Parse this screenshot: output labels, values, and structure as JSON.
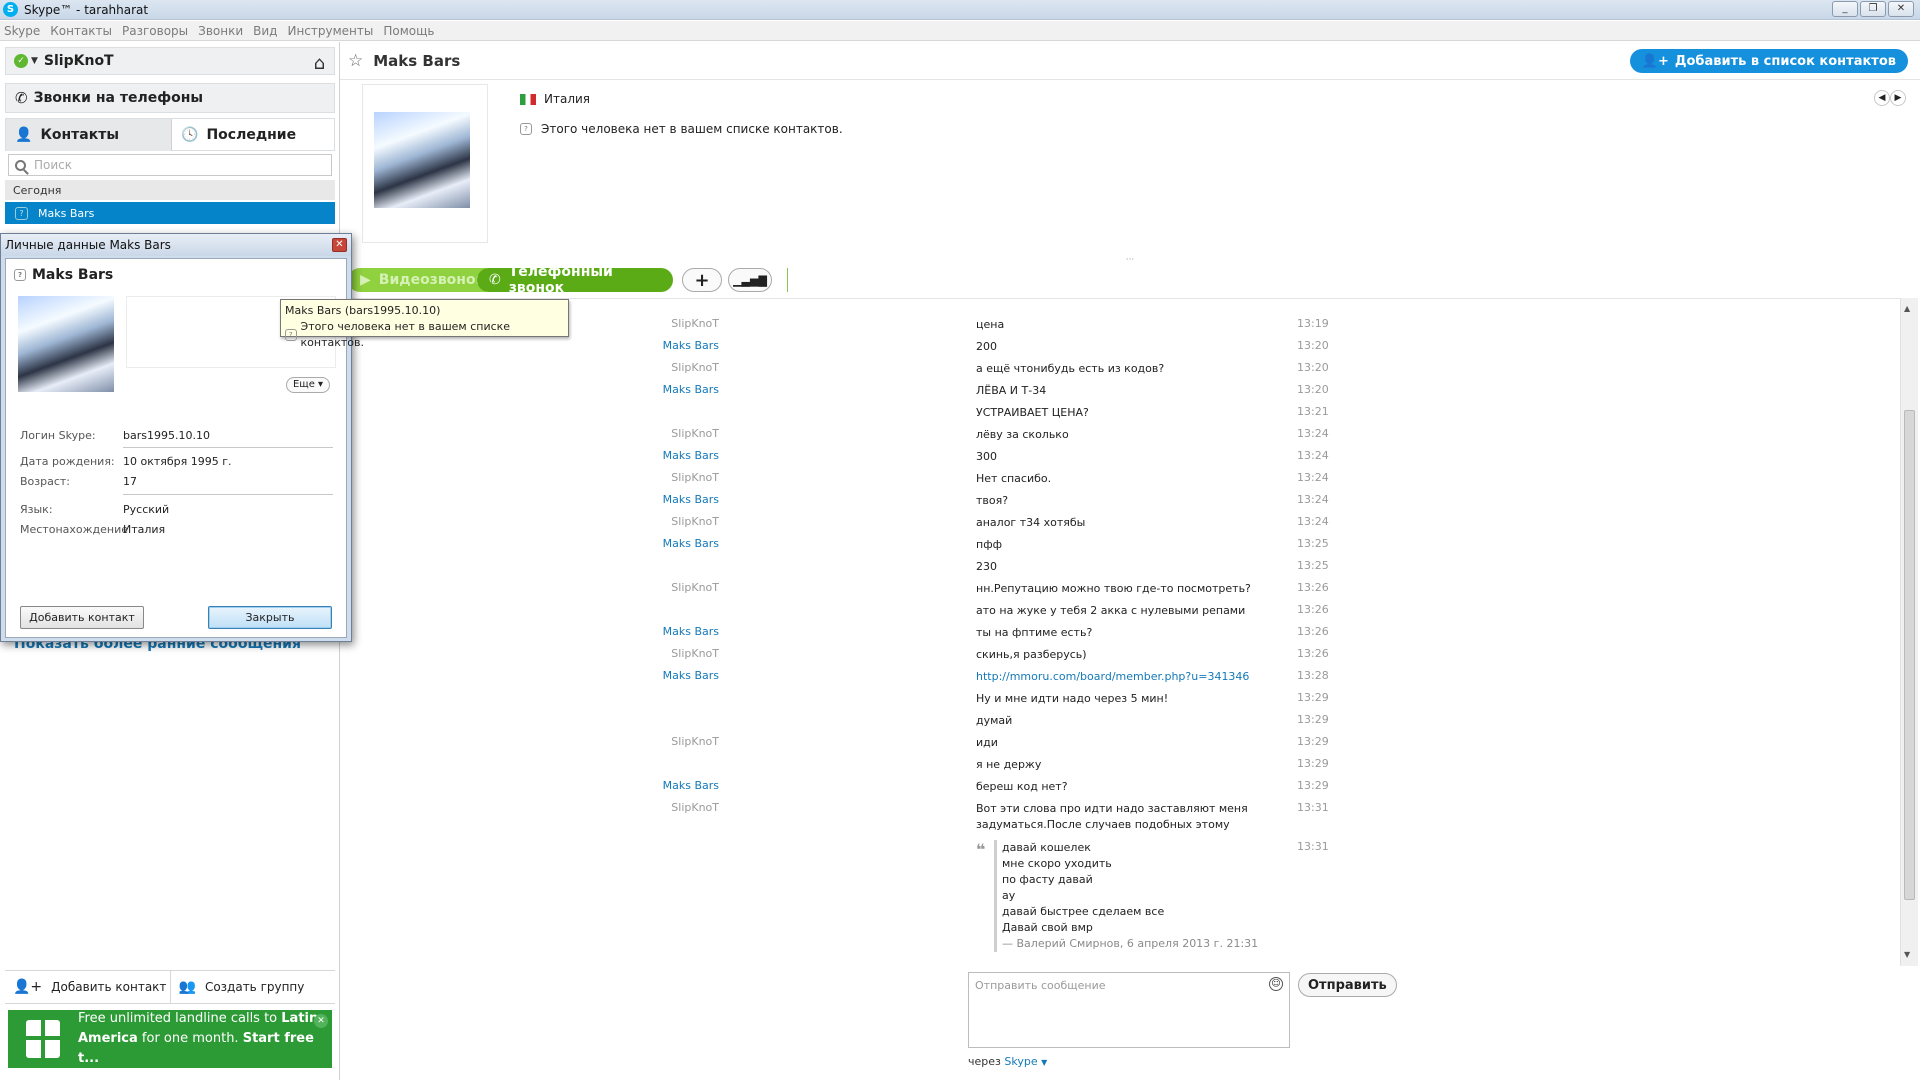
{
  "window": {
    "title": "Skype™ - tarahharat",
    "logo": "skype-logo",
    "controls": [
      "_",
      "❐",
      "✕"
    ]
  },
  "menu": [
    "Skype",
    "Контакты",
    "Разговоры",
    "Звонки",
    "Вид",
    "Инструменты",
    "Помощь"
  ],
  "sidebar": {
    "account_name": "SlipKnoT",
    "phone_calls": "Звонки на телефоны",
    "tabs": {
      "contacts": "Контакты",
      "recent": "Последние"
    },
    "search_placeholder": "Поиск",
    "group_header": "Сегодня",
    "selected_contact": "Maks Bars",
    "show_earlier": "Показать более ранние сообщения",
    "add_contact": "Добавить контакт",
    "create_group": "Создать группу",
    "promo": {
      "line1": "Free unlimited landline calls to ",
      "bold1": "Latin America",
      "line2": " for one month. ",
      "bold2": "Start free t..."
    }
  },
  "header": {
    "contact_name": "Maks Bars",
    "add_to_contacts": "Добавить в список контактов"
  },
  "profile": {
    "country": "Италия",
    "not_in_list": "Этого человека нет в вашем списке контактов."
  },
  "call_bar": {
    "video": "Видеозвонок",
    "phone": "Телефонный звонок"
  },
  "colors": {
    "accent": "#00aff0",
    "selected": "#0584c9",
    "call_green": "#5bab16",
    "link": "#1479b8"
  },
  "messages": [
    {
      "sender": "SlipKnoT",
      "text": "цена",
      "time": "13:19"
    },
    {
      "sender": "Maks Bars",
      "text": "200",
      "time": "13:20"
    },
    {
      "sender": "SlipKnoT",
      "text": "а ещё чтонибудь есть из кодов?",
      "time": "13:20"
    },
    {
      "sender": "Maks Bars",
      "text": "ЛЁВА И Т-34",
      "time": "13:20"
    },
    {
      "sender": "",
      "text": "УСТРАИВАЕТ ЦЕНА?",
      "time": "13:21"
    },
    {
      "sender": "SlipKnoT",
      "text": "лёву за сколько",
      "time": "13:24"
    },
    {
      "sender": "Maks Bars",
      "text": "300",
      "time": "13:24"
    },
    {
      "sender": "SlipKnoT",
      "text": "Нет спасибо.",
      "time": "13:24"
    },
    {
      "sender": "Maks Bars",
      "text": "твоя?",
      "time": "13:24"
    },
    {
      "sender": "SlipKnoT",
      "text": "аналог т34 хотябы",
      "time": "13:24"
    },
    {
      "sender": "Maks Bars",
      "text": "пфф",
      "time": "13:25"
    },
    {
      "sender": "",
      "text": "230",
      "time": "13:25"
    },
    {
      "sender": "SlipKnoT",
      "text": "нн.Репутацию можно твою где-то посмотреть?",
      "time": "13:26"
    },
    {
      "sender": "",
      "text": "ато на жуке у тебя 2 акка с нулевыми репами",
      "time": "13:26"
    },
    {
      "sender": "Maks Bars",
      "text": "ты на фптиме есть?",
      "time": "13:26"
    },
    {
      "sender": "SlipKnoT",
      "text": "скинь,я разберусь)",
      "time": "13:26"
    },
    {
      "sender": "Maks Bars",
      "text": "http://mmoru.com/board/member.php?u=341346",
      "time": "13:28",
      "link": true
    },
    {
      "sender": "",
      "text": "Ну и мне идти надо через 5 мин!",
      "time": "13:29"
    },
    {
      "sender": "",
      "text": "думай",
      "time": "13:29"
    },
    {
      "sender": "SlipKnoT",
      "text": "иди",
      "time": "13:29"
    },
    {
      "sender": "",
      "text": "я не держу",
      "time": "13:29"
    },
    {
      "sender": "Maks Bars",
      "text": "береш код нет?",
      "time": "13:29"
    },
    {
      "sender": "SlipKnoT",
      "text": "Вот эти слова про идти надо заставляют меня задуматься.После случаев подобных этому",
      "time": "13:31"
    }
  ],
  "quote": {
    "time": "13:31",
    "lines": [
      "давай кошелек",
      "мне скоро уходить",
      "по фасту давай",
      "ау",
      "давай быстрее сделаем все",
      "Давай свой вмр"
    ],
    "source": "— Валерий Смирнов, 6 апреля 2013 г. 21:31"
  },
  "composer": {
    "placeholder": "Отправить сообщение",
    "send": "Отправить",
    "via_prefix": "через ",
    "via": "Skype"
  },
  "dialog": {
    "title": "Личные данные Maks Bars",
    "name": "Maks Bars",
    "more": "Еще",
    "fields": [
      {
        "label": "Логин Skype:",
        "value": "bars1995.10.10"
      },
      {
        "label": "Дата рождения:",
        "value": "10 октября 1995 г."
      },
      {
        "label": "Возраст:",
        "value": "17"
      },
      {
        "label": "Язык:",
        "value": "Русский"
      },
      {
        "label": "Местонахождение",
        "value": "Италия"
      }
    ],
    "add_contact": "Добавить контакт",
    "close": "Закрыть"
  },
  "tooltip": {
    "line1": "Maks Bars (bars1995.10.10)",
    "line2": "Этого человека нет в вашем списке контактов."
  }
}
